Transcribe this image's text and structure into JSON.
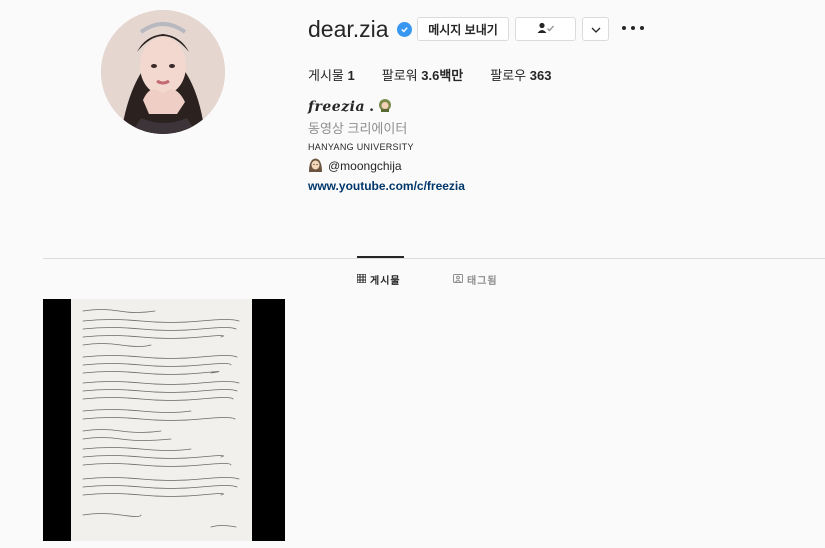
{
  "profile": {
    "username": "dear.zia",
    "verified": true,
    "message_button": "메시지 보내기",
    "follow_status_icon": "person-check-icon",
    "more_icon": "chevron-down-icon",
    "options_icon": "more-horizontal-icon",
    "stats": {
      "posts_label": "게시물",
      "posts_value": "1",
      "followers_label": "팔로워",
      "followers_value": "3.6백만",
      "following_label": "팔로우",
      "following_value": "363"
    },
    "full_name": "freezia",
    "category": "동영상 크리에이터",
    "bio_line": "HANYANG UNIVERSITY",
    "mention": "@moongchija",
    "website": "www.youtube.com/c/freezia"
  },
  "tabs": [
    {
      "label": "게시물",
      "icon": "grid-icon",
      "active": true
    },
    {
      "label": "태그됨",
      "icon": "tag-portrait-icon",
      "active": false
    }
  ],
  "posts": [
    {
      "type": "image",
      "description_icon": "handwritten-letter-image"
    }
  ],
  "colors": {
    "background": "#fafafa",
    "verified": "#3897f0",
    "link": "#00376b",
    "secondary_text": "#8e8e8e"
  }
}
